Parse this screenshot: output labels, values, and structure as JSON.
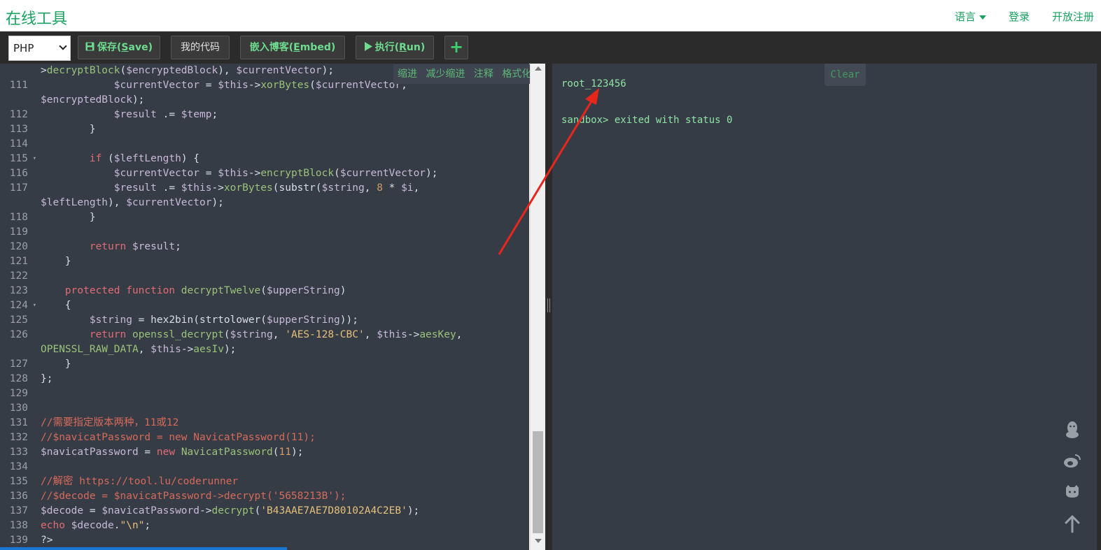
{
  "header": {
    "brand": "在线工具",
    "nav": {
      "language": "语言",
      "login": "登录",
      "register": "开放注册"
    }
  },
  "toolbar": {
    "language_selected": "PHP",
    "save_prefix": "保存(",
    "save_key": "S",
    "save_suffix": "ave)",
    "mycode": "我的代码",
    "embed_prefix": "嵌入博客(",
    "embed_key": "E",
    "embed_suffix": "mbed)",
    "run_prefix": "执行(",
    "run_key": "R",
    "run_suffix": "un)",
    "add": "+"
  },
  "editor_actions": [
    "缩进",
    "减少缩进",
    "注释",
    "格式化"
  ],
  "output": {
    "clear": "Clear",
    "line1": "root_123456",
    "line2": "sandbox> exited with status 0"
  },
  "icons": {
    "save": "floppy-icon",
    "run": "play-icon",
    "side": [
      "qq-icon",
      "weibo-icon",
      "github-icon",
      "back-to-top-icon"
    ]
  },
  "colors": {
    "accent": "#1aa260",
    "editor_bg": "#363c46",
    "toolbar_bg": "#2b2b2b",
    "annotation": "#e8261c"
  }
}
